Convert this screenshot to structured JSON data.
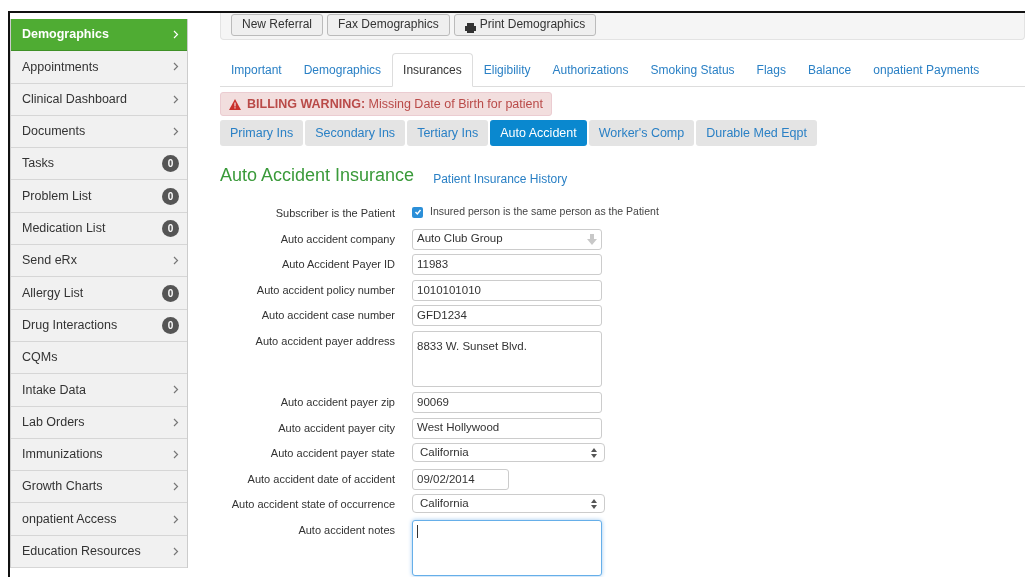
{
  "sidebar": {
    "items": [
      {
        "label": "Demographics",
        "selected": true,
        "kind": "chevron"
      },
      {
        "label": "Appointments",
        "selected": false,
        "kind": "chevron"
      },
      {
        "label": "Clinical Dashboard",
        "selected": false,
        "kind": "chevron"
      },
      {
        "label": "Documents",
        "selected": false,
        "kind": "chevron"
      },
      {
        "label": "Tasks",
        "selected": false,
        "kind": "badge",
        "badge": "0"
      },
      {
        "label": "Problem List",
        "selected": false,
        "kind": "badge",
        "badge": "0"
      },
      {
        "label": "Medication List",
        "selected": false,
        "kind": "badge",
        "badge": "0"
      },
      {
        "label": "Send eRx",
        "selected": false,
        "kind": "chevron"
      },
      {
        "label": "Allergy List",
        "selected": false,
        "kind": "badge",
        "badge": "0"
      },
      {
        "label": "Drug Interactions",
        "selected": false,
        "kind": "badge",
        "badge": "0"
      },
      {
        "label": "CQMs",
        "selected": false,
        "kind": "plain"
      },
      {
        "label": "Intake Data",
        "selected": false,
        "kind": "chevron"
      },
      {
        "label": "Lab Orders",
        "selected": false,
        "kind": "chevron"
      },
      {
        "label": "Immunizations",
        "selected": false,
        "kind": "chevron"
      },
      {
        "label": "Growth Charts",
        "selected": false,
        "kind": "chevron"
      },
      {
        "label": "onpatient Access",
        "selected": false,
        "kind": "chevron"
      },
      {
        "label": "Education Resources",
        "selected": false,
        "kind": "chevron"
      }
    ]
  },
  "toolbar": {
    "buttons": [
      {
        "label": "New Referral",
        "kind": "plain"
      },
      {
        "label": "Fax Demographics",
        "kind": "plain"
      },
      {
        "label": "Print Demographics",
        "kind": "print"
      }
    ]
  },
  "tabs": [
    {
      "label": "Important",
      "selected": false
    },
    {
      "label": "Demographics",
      "selected": false
    },
    {
      "label": "Insurances",
      "selected": true
    },
    {
      "label": "Eligibility",
      "selected": false
    },
    {
      "label": "Authorizations",
      "selected": false
    },
    {
      "label": "Smoking Status",
      "selected": false
    },
    {
      "label": "Flags",
      "selected": false
    },
    {
      "label": "Balance",
      "selected": false
    },
    {
      "label": "onpatient Payments",
      "selected": false
    }
  ],
  "warning": {
    "title": "BILLING WARNING:",
    "message": "Missing Date of Birth for patient"
  },
  "insurance_tabs": [
    {
      "label": "Primary Ins",
      "selected": false
    },
    {
      "label": "Secondary Ins",
      "selected": false
    },
    {
      "label": "Tertiary Ins",
      "selected": false
    },
    {
      "label": "Auto Accident",
      "selected": true
    },
    {
      "label": "Worker's Comp",
      "selected": false
    },
    {
      "label": "Durable Med Eqpt",
      "selected": false
    }
  ],
  "heading": "Auto Accident Insurance",
  "history_link": "Patient Insurance History",
  "fields": [
    {
      "label": "Subscriber is the Patient",
      "kind": "checkbox",
      "checked": true,
      "value": "Insured person is the same person as the Patient"
    },
    {
      "label": "Auto accident company",
      "kind": "combo",
      "value": "Auto Club Group"
    },
    {
      "label": "Auto Accident Payer ID",
      "kind": "text",
      "value": "11983"
    },
    {
      "label": "Auto accident policy number",
      "kind": "text",
      "value": "1010101010"
    },
    {
      "label": "Auto accident case number",
      "kind": "text",
      "value": "GFD1234"
    },
    {
      "label": "Auto accident payer address",
      "kind": "textarea",
      "value": "8833 W. Sunset Blvd."
    },
    {
      "label": "Auto accident payer zip",
      "kind": "text",
      "value": "90069"
    },
    {
      "label": "Auto accident payer city",
      "kind": "text",
      "value": "West Hollywood"
    },
    {
      "label": "Auto accident payer state",
      "kind": "select",
      "value": "California"
    },
    {
      "label": "Auto accident date of accident",
      "kind": "date",
      "value": "09/02/2014"
    },
    {
      "label": "Auto accident state of occurrence",
      "kind": "select",
      "value": "California"
    },
    {
      "label": "Auto accident notes",
      "kind": "notes",
      "focused": true
    }
  ]
}
